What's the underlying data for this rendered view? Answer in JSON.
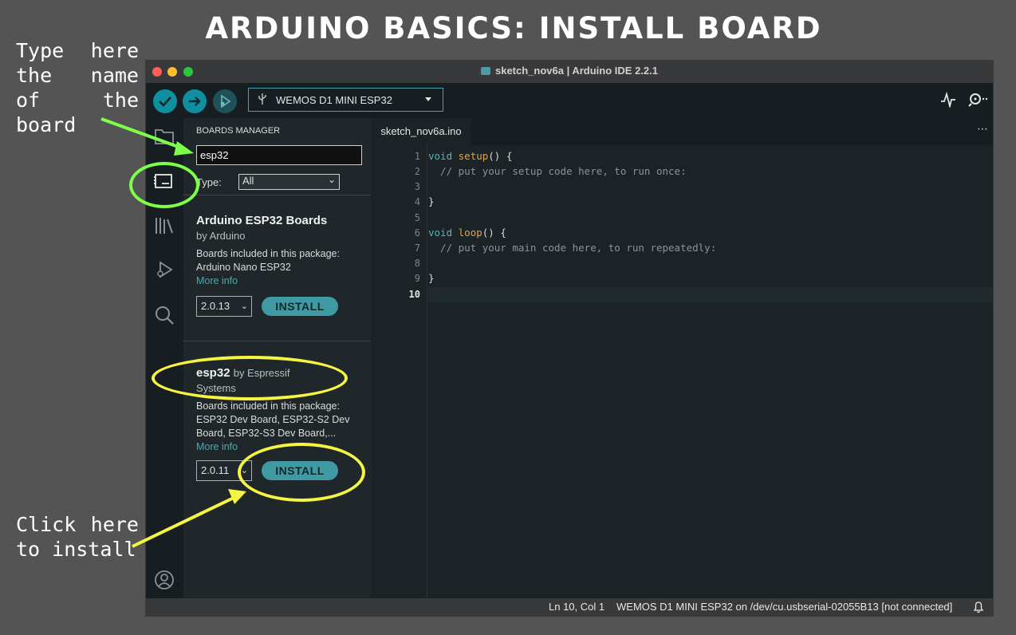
{
  "banner": {
    "title": "ARDUINO BASICS:  INSTALL BOARD",
    "annotation_type": "Type here the name of the board",
    "annotation_click_line1_a": "Click",
    "annotation_click_line1_b": "here",
    "annotation_click_line2": "to install"
  },
  "window": {
    "title": "sketch_nov6a | Arduino IDE 2.2.1"
  },
  "toolbar": {
    "verify_icon": "check-icon",
    "upload_icon": "arrow-right-icon",
    "debug_icon": "debug-icon",
    "board_selected": "WEMOS D1 MINI ESP32",
    "serial_plotter_icon": "pulse-icon",
    "serial_monitor_icon": "magnifier-icon"
  },
  "sidebar": {
    "items": [
      {
        "icon": "folder-icon"
      },
      {
        "icon": "boards-manager-icon"
      },
      {
        "icon": "library-icon"
      },
      {
        "icon": "debug-icon"
      },
      {
        "icon": "search-icon"
      },
      {
        "icon": "user-icon"
      }
    ]
  },
  "boards_manager": {
    "title": "BOARDS MANAGER",
    "search_value": "esp32",
    "type_label": "Type:",
    "type_value": "All",
    "packages": [
      {
        "name": "Arduino ESP32 Boards",
        "author": "by Arduino",
        "included_label": "Boards included in this package:",
        "included": "Arduino Nano ESP32",
        "more_info": "More info",
        "version": "2.0.13",
        "install_label": "INSTALL"
      },
      {
        "name": "esp32",
        "by": "by Espressif",
        "author": "Systems",
        "included_label": "Boards included in this package:",
        "included": "ESP32 Dev Board, ESP32-S2 Dev Board, ESP32-S3 Dev Board,...",
        "more_info": "More info",
        "version": "2.0.11",
        "install_label": "INSTALL"
      }
    ]
  },
  "editor": {
    "tab_name": "sketch_nov6a.ino",
    "line_numbers": [
      "1",
      "2",
      "3",
      "4",
      "5",
      "6",
      "7",
      "8",
      "9",
      "10"
    ],
    "code": {
      "l1_kw": "void",
      "l1_fn": "setup",
      "l1_rest": "() {",
      "l2": "  // put your setup code here, to run once:",
      "l4": "}",
      "l6_kw": "void",
      "l6_fn": "loop",
      "l6_rest": "() {",
      "l7": "  // put your main code here, to run repeatedly:",
      "l9": "}"
    }
  },
  "statusbar": {
    "position": "Ln 10, Col 1",
    "board_port": "WEMOS D1 MINI ESP32 on /dev/cu.usbserial-02055B13 [not connected]"
  },
  "colors": {
    "accent": "#0f8f9f",
    "green_highlight": "#7dff4a",
    "yellow_highlight": "#f5f542"
  }
}
